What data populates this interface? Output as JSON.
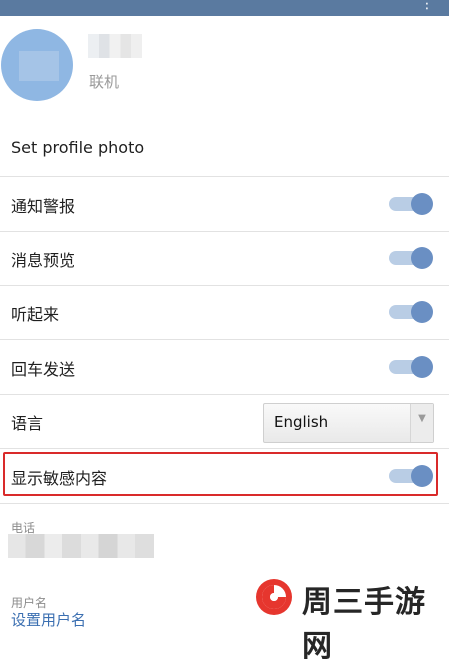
{
  "header": {
    "menu_glyph": "⋮"
  },
  "profile": {
    "status": "联机"
  },
  "settings": {
    "set_photo": "Set profile photo",
    "notifications": {
      "label": "通知警报",
      "on": true
    },
    "message_preview": {
      "label": "消息预览",
      "on": true
    },
    "sounds": {
      "label": "听起来",
      "on": true
    },
    "enter_to_send": {
      "label": "回车发送",
      "on": true
    },
    "language": {
      "label": "语言",
      "value": "English"
    },
    "sensitive_content": {
      "label": "显示敏感内容",
      "on": true
    }
  },
  "fields": {
    "phone_label": "电话",
    "username_label": "用户名",
    "username_value": "设置用户名"
  },
  "watermark": {
    "text": "周三手游网"
  },
  "colors": {
    "toggle_on": "#6a8fc3",
    "highlight": "#d92a2a",
    "topbar": "#5a7aa0",
    "link": "#3b6fb1"
  }
}
